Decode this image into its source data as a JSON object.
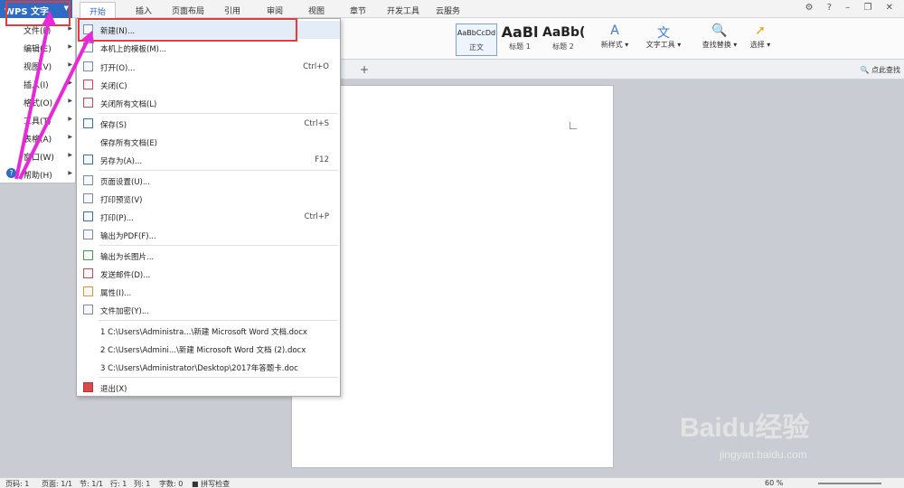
{
  "app": {
    "name": "WPS 文字"
  },
  "ribbon_tabs": [
    "开始",
    "插入",
    "页面布局",
    "引用",
    "审阅",
    "视图",
    "章节",
    "开发工具",
    "云服务"
  ],
  "styles": [
    {
      "sample": "AaBbCcDd",
      "name": "正文"
    },
    {
      "sample": "AaBl",
      "name": "标题 1"
    },
    {
      "sample": "AaBb(",
      "name": "标题 2"
    }
  ],
  "ribbon_buttons": {
    "new_style": "新样式",
    "text_tools": "文字工具",
    "find_replace": "查找替换",
    "select": "选择"
  },
  "find_command": "点此查找",
  "side_menu": [
    {
      "label": "文件(F)"
    },
    {
      "label": "编辑(E)"
    },
    {
      "label": "视图(V)"
    },
    {
      "label": "插入(I)"
    },
    {
      "label": "格式(O)"
    },
    {
      "label": "工具(T)"
    },
    {
      "label": "表格(A)"
    },
    {
      "label": "窗口(W)"
    },
    {
      "label": "帮助(H)"
    }
  ],
  "file_menu": {
    "new": "新建(N)...",
    "templates": "本机上的模板(M)...",
    "open": {
      "label": "打开(O)...",
      "shortcut": "Ctrl+O"
    },
    "close": "关闭(C)",
    "close_all": "关闭所有文档(L)",
    "save": {
      "label": "保存(S)",
      "shortcut": "Ctrl+S"
    },
    "save_all": "保存所有文档(E)",
    "save_as": {
      "label": "另存为(A)...",
      "shortcut": "F12"
    },
    "page_setup": "页面设置(U)...",
    "print_preview": "打印预览(V)",
    "print": {
      "label": "打印(P)...",
      "shortcut": "Ctrl+P"
    },
    "export_pdf": "输出为PDF(F)...",
    "export_image": "输出为长图片...",
    "send_mail": "发送邮件(D)...",
    "properties": "属性(I)...",
    "encrypt": "文件加密(Y)...",
    "recent": [
      "1 C:\\Users\\Administra...\\新建 Microsoft Word 文档.docx",
      "2 C:\\Users\\Admini...\\新建 Microsoft Word 文档 (2).docx",
      "3 C:\\Users\\Administrator\\Desktop\\2017年答题卡.doc"
    ],
    "exit": "退出(X)"
  },
  "status_bar": {
    "page_no": "页码: 1",
    "pages": "页面: 1/1",
    "section": "节: 1/1",
    "row": "行: 1",
    "col": "列: 1",
    "words": "字数: 0",
    "spellcheck": "拼写检查",
    "zoom": "60 %"
  },
  "watermark": {
    "brand": "Baidu经验",
    "url": "jingyan.baidu.com"
  },
  "colors": {
    "accent": "#2d6bc4",
    "highlight": "#e23c3c",
    "annotation": "#e829d8"
  }
}
